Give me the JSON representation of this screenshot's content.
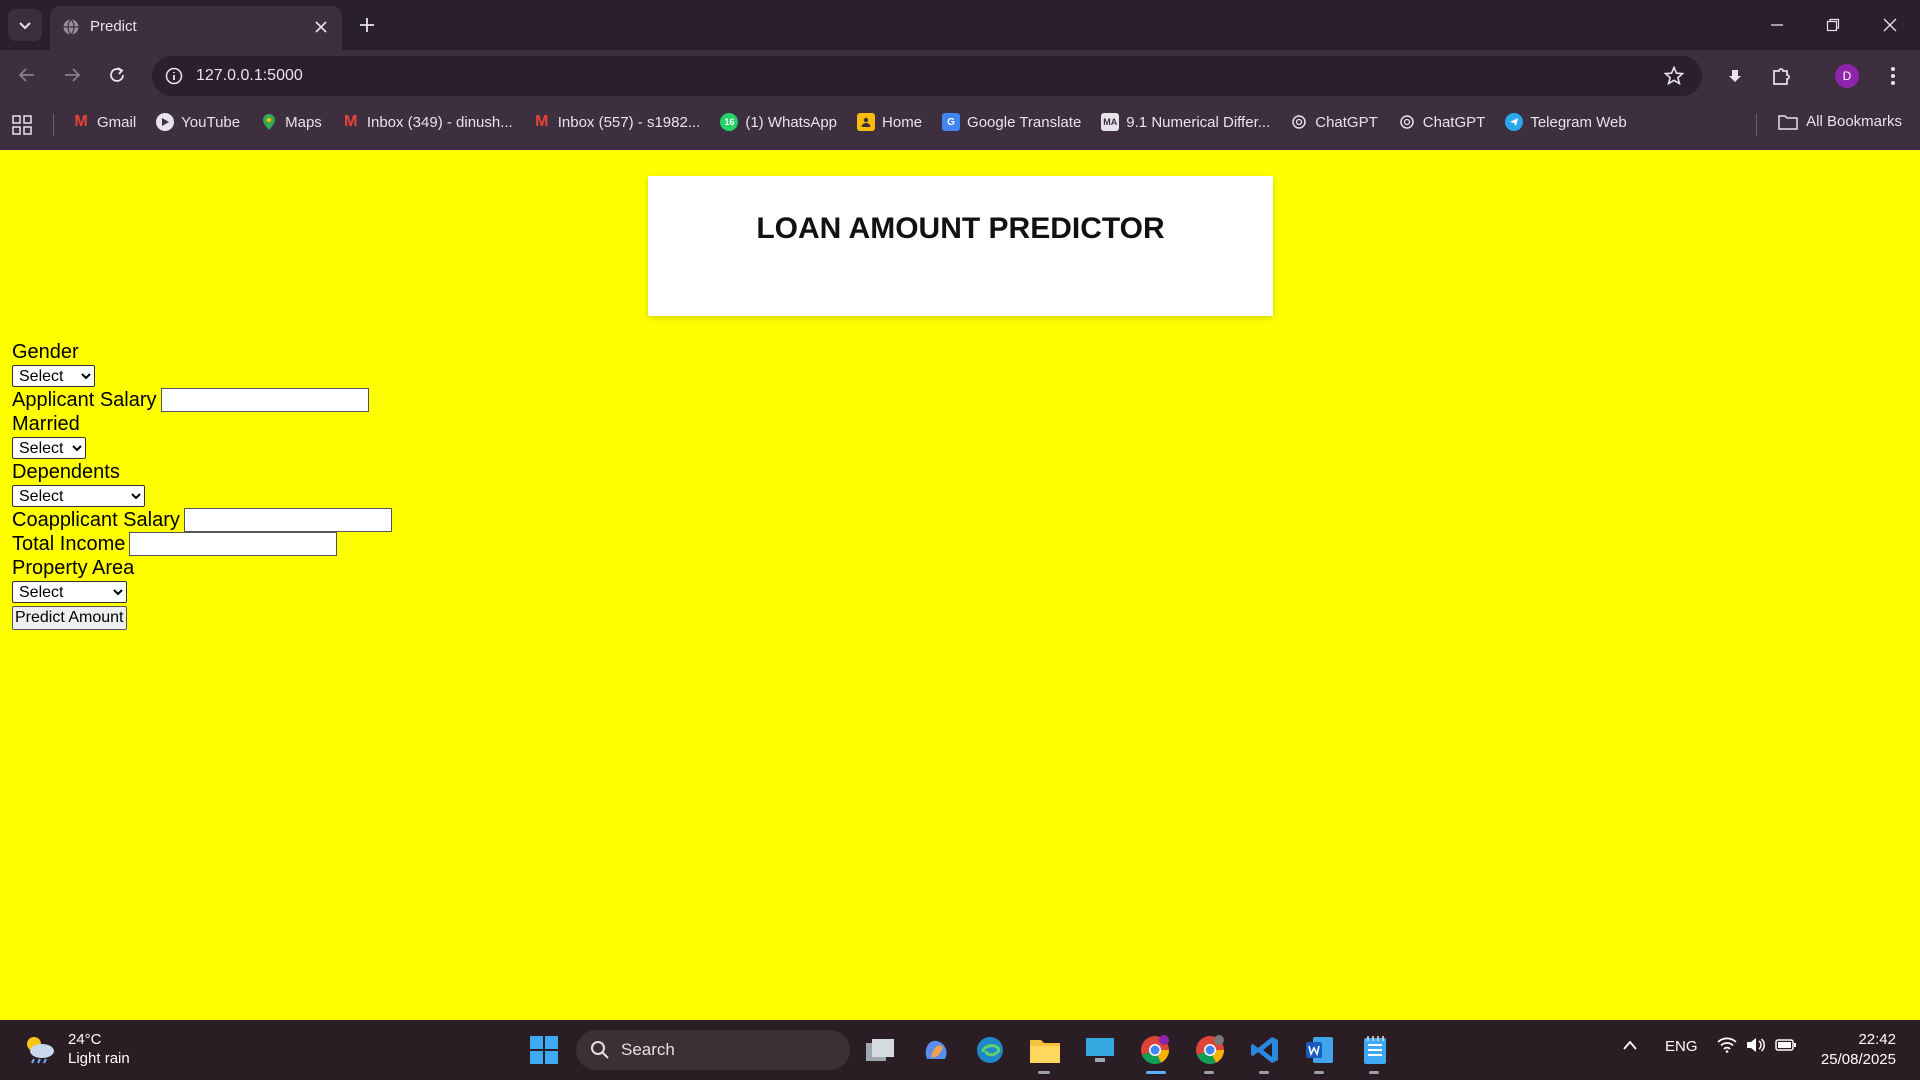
{
  "browser": {
    "tab_title": "Predict",
    "url": "127.0.0.1:5000",
    "profile_initial": "D"
  },
  "bookmarks": {
    "items": [
      {
        "label": "Gmail",
        "icon": "gmail-icon"
      },
      {
        "label": "YouTube",
        "icon": "youtube-icon"
      },
      {
        "label": "Maps",
        "icon": "maps-icon"
      },
      {
        "label": "Inbox (349) - dinush...",
        "icon": "gmail-icon"
      },
      {
        "label": "Inbox (557) - s1982...",
        "icon": "gmail-icon"
      },
      {
        "label": "(1) WhatsApp",
        "icon": "whatsapp-icon"
      },
      {
        "label": "Home",
        "icon": "home-icon"
      },
      {
        "label": "Google Translate",
        "icon": "translate-icon"
      },
      {
        "label": "9.1 Numerical Differ...",
        "icon": "document-icon"
      },
      {
        "label": "ChatGPT",
        "icon": "chatgpt-icon"
      },
      {
        "label": "ChatGPT",
        "icon": "chatgpt-icon"
      },
      {
        "label": "Telegram Web",
        "icon": "telegram-icon"
      }
    ],
    "all_bookmarks": "All Bookmarks"
  },
  "page": {
    "title": "LOAN AMOUNT PREDICTOR",
    "form": {
      "gender_label": "Gender",
      "gender_value": "Select",
      "applicant_salary_label": "Applicant Salary",
      "applicant_salary_value": "",
      "married_label": "Married",
      "married_value": "Select",
      "dependents_label": "Dependents",
      "dependents_value": "Select",
      "coapplicant_salary_label": "Coapplicant Salary",
      "coapplicant_salary_value": "",
      "total_income_label": "Total Income",
      "total_income_value": "",
      "property_area_label": "Property Area",
      "property_area_value": "Select",
      "submit_label": "Predict Amount"
    }
  },
  "taskbar": {
    "weather_temp": "24°C",
    "weather_desc": "Light rain",
    "search_label": "Search",
    "language": "ENG",
    "time": "22:42",
    "date": "25/08/2025"
  },
  "colors": {
    "page_background": "#ffff00",
    "chrome_frame": "#2a1f2d",
    "chrome_toolbar": "#3d2f40"
  }
}
